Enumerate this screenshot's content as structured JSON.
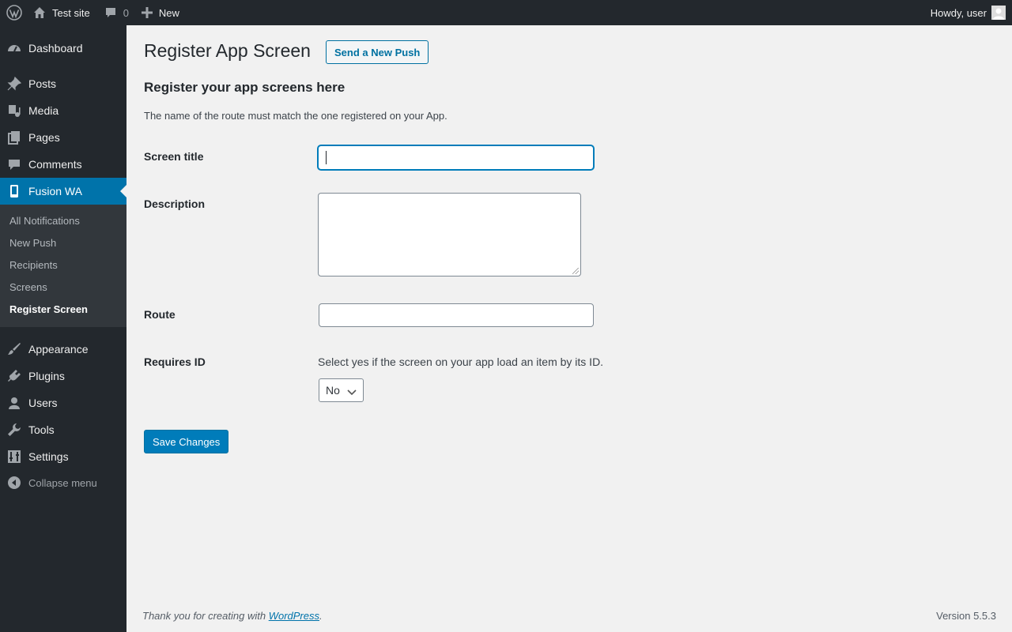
{
  "admin_bar": {
    "site_name": "Test site",
    "comments_count": "0",
    "new_label": "New",
    "howdy": "Howdy, user"
  },
  "sidebar": {
    "items": [
      {
        "label": "Dashboard",
        "icon": "dashboard-icon"
      },
      {
        "label": "Posts",
        "icon": "pushpin-icon"
      },
      {
        "label": "Media",
        "icon": "media-icon"
      },
      {
        "label": "Pages",
        "icon": "pages-icon"
      },
      {
        "label": "Comments",
        "icon": "comment-icon"
      },
      {
        "label": "Fusion WA",
        "icon": "mobile-icon"
      },
      {
        "label": "Appearance",
        "icon": "paintbrush-icon"
      },
      {
        "label": "Plugins",
        "icon": "plugin-icon"
      },
      {
        "label": "Users",
        "icon": "users-icon"
      },
      {
        "label": "Tools",
        "icon": "wrench-icon"
      },
      {
        "label": "Settings",
        "icon": "settings-icon"
      }
    ],
    "submenu": [
      "All Notifications",
      "New Push",
      "Recipients",
      "Screens",
      "Register Screen"
    ],
    "collapse_label": "Collapse menu"
  },
  "main": {
    "page_title": "Register App Screen",
    "title_action": "Send a New Push",
    "section_title": "Register your app screens here",
    "section_desc": "The name of the route must match the one registered on your App.",
    "fields": {
      "screen_title": {
        "label": "Screen title",
        "value": ""
      },
      "description": {
        "label": "Description",
        "value": ""
      },
      "route": {
        "label": "Route",
        "value": ""
      },
      "requires_id": {
        "label": "Requires ID",
        "help": "Select yes if the screen on your app load an item by its ID.",
        "value": "No"
      }
    },
    "save_button": "Save Changes"
  },
  "footer": {
    "thanks_prefix": "Thank you for creating with ",
    "thanks_link": "WordPress",
    "thanks_suffix": ".",
    "version": "Version 5.5.3"
  },
  "colors": {
    "admin_bar_bg": "#23282d",
    "accent": "#0073aa",
    "button_primary": "#007cba"
  }
}
